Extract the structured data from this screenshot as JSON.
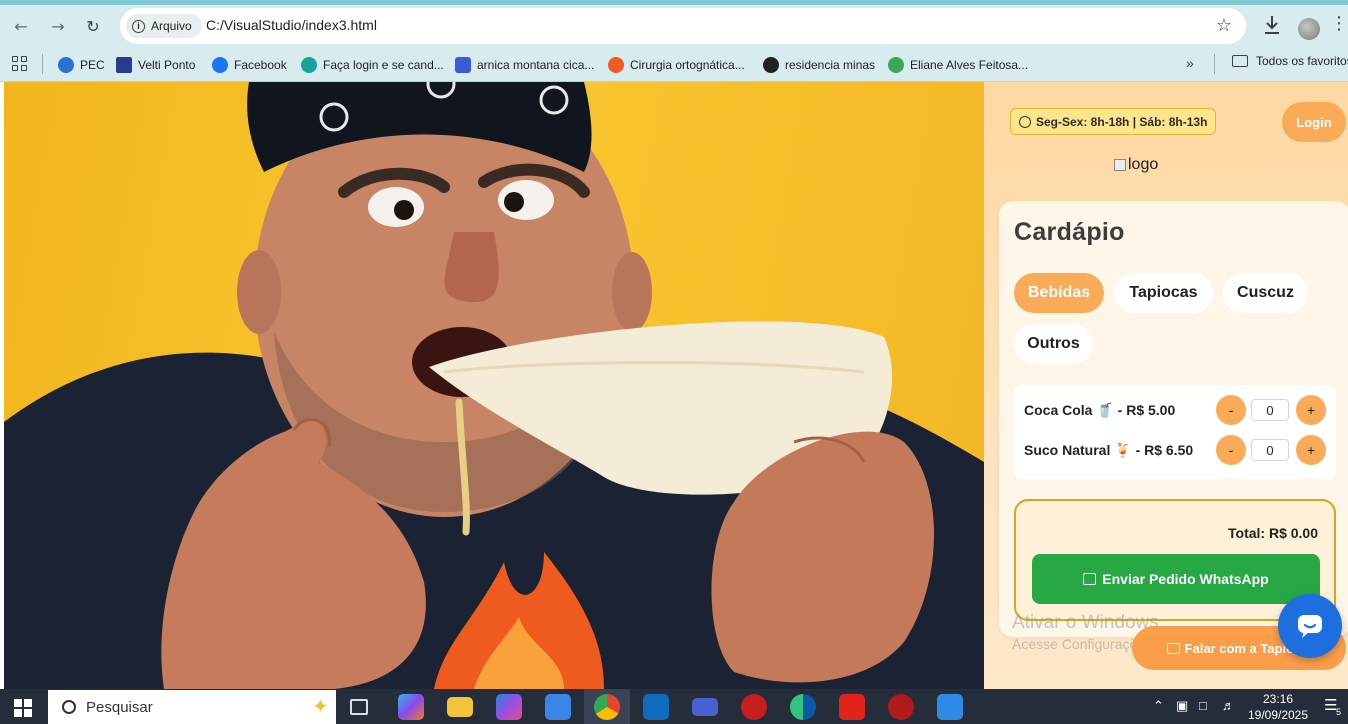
{
  "browser": {
    "security_chip": "Arquivo",
    "url": "C:/VisualStudio/index3.html",
    "bookmarks": [
      {
        "label": "PEC",
        "color": "#2f6fcf"
      },
      {
        "label": "Velti Ponto",
        "color": "#2c3a8c"
      },
      {
        "label": "Facebook",
        "color": "#1877f2"
      },
      {
        "label": "Faça login e se cand...",
        "color": "#15a39a"
      },
      {
        "label": "arnica montana cica...",
        "color": "#3b5bd6"
      },
      {
        "label": "Cirurgia ortognática...",
        "color": "#f05a22"
      },
      {
        "label": "residencia minas",
        "color": "#222222"
      },
      {
        "label": "Eliane Alves Feitosa...",
        "color": "#3aa657"
      }
    ],
    "bookmarks_folder": "Todos os favoritos"
  },
  "page": {
    "hours": "Seg-Sex: 8h-18h | Sáb: 8h-13h",
    "login_label": "Login",
    "logo_alt": "logo",
    "menu_title": "Cardápio",
    "tabs": [
      {
        "label": "Bebidas",
        "active": true
      },
      {
        "label": "Tapiocas",
        "active": false
      },
      {
        "label": "Cuscuz",
        "active": false
      },
      {
        "label": "Outros",
        "active": false
      }
    ],
    "items": [
      {
        "label": "Coca Cola 🥤 - R$ 5.00",
        "qty": "0",
        "minus": "-",
        "plus": "+"
      },
      {
        "label": "Suco Natural 🍹 - R$ 6.50",
        "qty": "0",
        "minus": "-",
        "plus": "+"
      }
    ],
    "total": "Total: R$ 0.00",
    "whatsapp_button": "Enviar Pedido WhatsApp",
    "talk_button": "Falar com a Tapiows",
    "accent_color": "#f9ab58",
    "whatsapp_color": "#28a745"
  },
  "windows_watermark": {
    "line1": "Ativar o Windows",
    "line2": "Acesse Configurações para ativar o Windows."
  },
  "taskbar": {
    "search_placeholder": "Pesquisar",
    "time": "23:16",
    "date": "19/09/2025",
    "notifications": "5"
  }
}
